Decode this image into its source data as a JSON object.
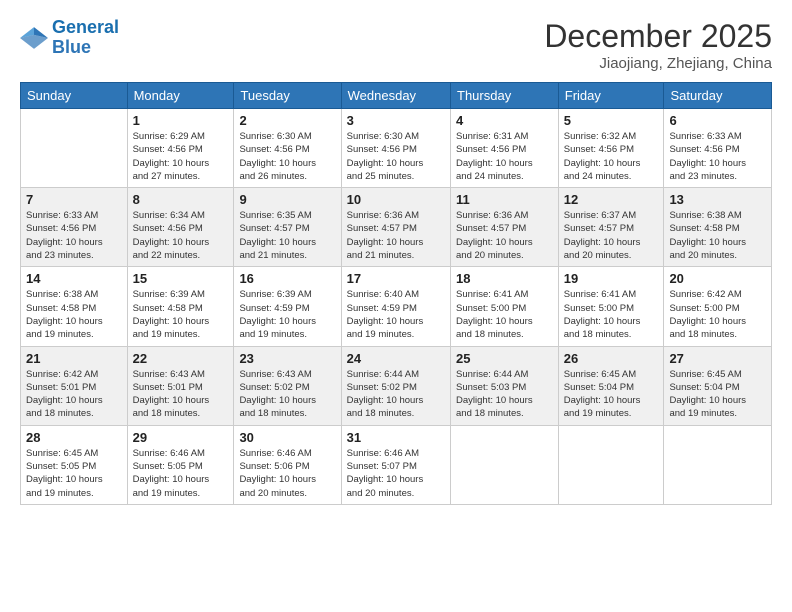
{
  "logo": {
    "line1": "General",
    "line2": "Blue"
  },
  "title": "December 2025",
  "subtitle": "Jiaojiang, Zhejiang, China",
  "days_of_week": [
    "Sunday",
    "Monday",
    "Tuesday",
    "Wednesday",
    "Thursday",
    "Friday",
    "Saturday"
  ],
  "weeks": [
    [
      {
        "day": "",
        "info": ""
      },
      {
        "day": "1",
        "info": "Sunrise: 6:29 AM\nSunset: 4:56 PM\nDaylight: 10 hours\nand 27 minutes."
      },
      {
        "day": "2",
        "info": "Sunrise: 6:30 AM\nSunset: 4:56 PM\nDaylight: 10 hours\nand 26 minutes."
      },
      {
        "day": "3",
        "info": "Sunrise: 6:30 AM\nSunset: 4:56 PM\nDaylight: 10 hours\nand 25 minutes."
      },
      {
        "day": "4",
        "info": "Sunrise: 6:31 AM\nSunset: 4:56 PM\nDaylight: 10 hours\nand 24 minutes."
      },
      {
        "day": "5",
        "info": "Sunrise: 6:32 AM\nSunset: 4:56 PM\nDaylight: 10 hours\nand 24 minutes."
      },
      {
        "day": "6",
        "info": "Sunrise: 6:33 AM\nSunset: 4:56 PM\nDaylight: 10 hours\nand 23 minutes."
      }
    ],
    [
      {
        "day": "7",
        "info": "Sunrise: 6:33 AM\nSunset: 4:56 PM\nDaylight: 10 hours\nand 23 minutes."
      },
      {
        "day": "8",
        "info": "Sunrise: 6:34 AM\nSunset: 4:56 PM\nDaylight: 10 hours\nand 22 minutes."
      },
      {
        "day": "9",
        "info": "Sunrise: 6:35 AM\nSunset: 4:57 PM\nDaylight: 10 hours\nand 21 minutes."
      },
      {
        "day": "10",
        "info": "Sunrise: 6:36 AM\nSunset: 4:57 PM\nDaylight: 10 hours\nand 21 minutes."
      },
      {
        "day": "11",
        "info": "Sunrise: 6:36 AM\nSunset: 4:57 PM\nDaylight: 10 hours\nand 20 minutes."
      },
      {
        "day": "12",
        "info": "Sunrise: 6:37 AM\nSunset: 4:57 PM\nDaylight: 10 hours\nand 20 minutes."
      },
      {
        "day": "13",
        "info": "Sunrise: 6:38 AM\nSunset: 4:58 PM\nDaylight: 10 hours\nand 20 minutes."
      }
    ],
    [
      {
        "day": "14",
        "info": "Sunrise: 6:38 AM\nSunset: 4:58 PM\nDaylight: 10 hours\nand 19 minutes."
      },
      {
        "day": "15",
        "info": "Sunrise: 6:39 AM\nSunset: 4:58 PM\nDaylight: 10 hours\nand 19 minutes."
      },
      {
        "day": "16",
        "info": "Sunrise: 6:39 AM\nSunset: 4:59 PM\nDaylight: 10 hours\nand 19 minutes."
      },
      {
        "day": "17",
        "info": "Sunrise: 6:40 AM\nSunset: 4:59 PM\nDaylight: 10 hours\nand 19 minutes."
      },
      {
        "day": "18",
        "info": "Sunrise: 6:41 AM\nSunset: 5:00 PM\nDaylight: 10 hours\nand 18 minutes."
      },
      {
        "day": "19",
        "info": "Sunrise: 6:41 AM\nSunset: 5:00 PM\nDaylight: 10 hours\nand 18 minutes."
      },
      {
        "day": "20",
        "info": "Sunrise: 6:42 AM\nSunset: 5:00 PM\nDaylight: 10 hours\nand 18 minutes."
      }
    ],
    [
      {
        "day": "21",
        "info": "Sunrise: 6:42 AM\nSunset: 5:01 PM\nDaylight: 10 hours\nand 18 minutes."
      },
      {
        "day": "22",
        "info": "Sunrise: 6:43 AM\nSunset: 5:01 PM\nDaylight: 10 hours\nand 18 minutes."
      },
      {
        "day": "23",
        "info": "Sunrise: 6:43 AM\nSunset: 5:02 PM\nDaylight: 10 hours\nand 18 minutes."
      },
      {
        "day": "24",
        "info": "Sunrise: 6:44 AM\nSunset: 5:02 PM\nDaylight: 10 hours\nand 18 minutes."
      },
      {
        "day": "25",
        "info": "Sunrise: 6:44 AM\nSunset: 5:03 PM\nDaylight: 10 hours\nand 18 minutes."
      },
      {
        "day": "26",
        "info": "Sunrise: 6:45 AM\nSunset: 5:04 PM\nDaylight: 10 hours\nand 19 minutes."
      },
      {
        "day": "27",
        "info": "Sunrise: 6:45 AM\nSunset: 5:04 PM\nDaylight: 10 hours\nand 19 minutes."
      }
    ],
    [
      {
        "day": "28",
        "info": "Sunrise: 6:45 AM\nSunset: 5:05 PM\nDaylight: 10 hours\nand 19 minutes."
      },
      {
        "day": "29",
        "info": "Sunrise: 6:46 AM\nSunset: 5:05 PM\nDaylight: 10 hours\nand 19 minutes."
      },
      {
        "day": "30",
        "info": "Sunrise: 6:46 AM\nSunset: 5:06 PM\nDaylight: 10 hours\nand 20 minutes."
      },
      {
        "day": "31",
        "info": "Sunrise: 6:46 AM\nSunset: 5:07 PM\nDaylight: 10 hours\nand 20 minutes."
      },
      {
        "day": "",
        "info": ""
      },
      {
        "day": "",
        "info": ""
      },
      {
        "day": "",
        "info": ""
      }
    ]
  ]
}
